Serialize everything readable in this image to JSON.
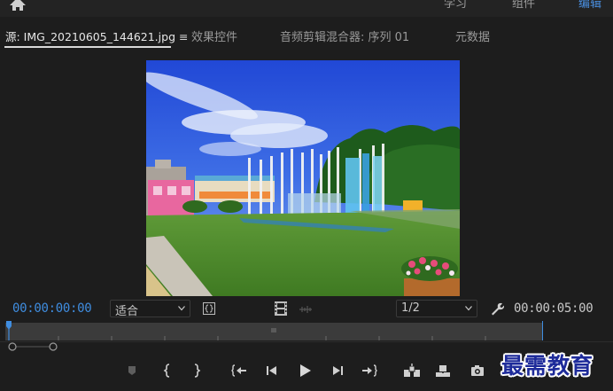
{
  "workspaces": {
    "learn": "学习",
    "assembly": "组件",
    "edit": "编辑"
  },
  "panel_tabs": {
    "source": "源: IMG_20210605_144621.jpg",
    "effect_controls": "效果控件",
    "audio_mixer": "音频剪辑混合器: 序列 01",
    "metadata": "元数据"
  },
  "viewer": {
    "timecode_current": "00:00:00:00",
    "zoom_value": "适合",
    "resolution_value": "1/2",
    "timecode_duration": "00:00:05:00",
    "playhead_position": 0
  },
  "icons": {
    "home": "home-icon",
    "panel_menu": "hamburger-icon",
    "insert": "insert-icon",
    "filmstrip": "filmstrip-icon",
    "drag_audio": "waveform-icon",
    "settings": "wrench-icon"
  },
  "transport": [
    "add-marker-icon",
    "mark-in-icon",
    "mark-out-icon",
    "go-to-in-icon",
    "step-back-icon",
    "play-icon",
    "step-forward-icon",
    "go-to-out-icon",
    "insert-icon",
    "overwrite-icon",
    "export-frame-icon"
  ],
  "watermark": "最需教育",
  "colors": {
    "accent": "#3f8de0",
    "background": "#1d1d1d",
    "ruler": "#3b3b3b",
    "watermark": "#1e2b9a"
  }
}
